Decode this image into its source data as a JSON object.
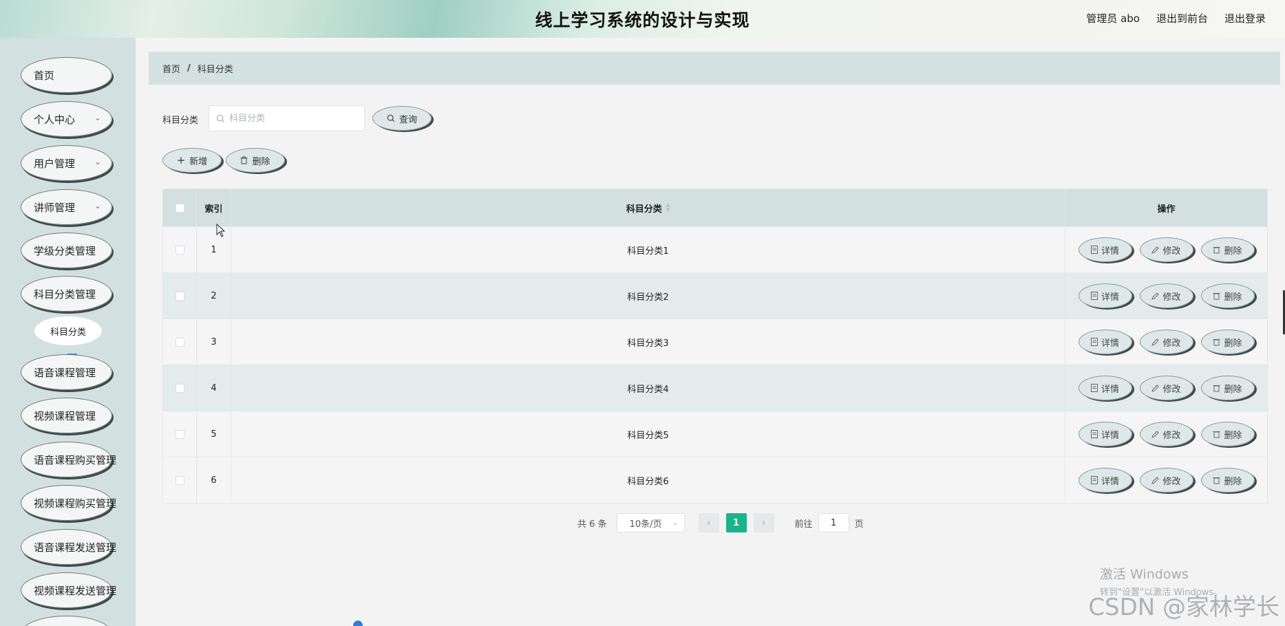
{
  "header": {
    "title": "线上学习系统的设计与实现",
    "user_label": "管理员 abo",
    "front_link": "退出到前台",
    "logout_link": "退出登录"
  },
  "sidebar": {
    "items": [
      {
        "label": "首页",
        "has_arrow": false
      },
      {
        "label": "个人中心",
        "has_arrow": true
      },
      {
        "label": "用户管理",
        "has_arrow": true
      },
      {
        "label": "讲师管理",
        "has_arrow": true
      },
      {
        "label": "学级分类管理",
        "has_arrow": false
      },
      {
        "label": "科目分类管理",
        "has_arrow": false
      },
      {
        "label": "语音课程管理",
        "has_arrow": false
      },
      {
        "label": "视频课程管理",
        "has_arrow": false
      },
      {
        "label": "语音课程购买管理",
        "has_arrow": false
      },
      {
        "label": "视频课程购买管理",
        "has_arrow": false
      },
      {
        "label": "语音课程发送管理",
        "has_arrow": false
      },
      {
        "label": "视频课程发送管理",
        "has_arrow": false
      }
    ],
    "sub_item": "科目分类"
  },
  "breadcrumb": {
    "home": "首页",
    "separator": "/",
    "current": "科目分类"
  },
  "search": {
    "label": "科目分类",
    "placeholder": "科目分类",
    "button": "查询"
  },
  "actions": {
    "add": "新增",
    "delete": "删除"
  },
  "table": {
    "headers": {
      "index": "索引",
      "name": "科目分类",
      "ops": "操作"
    },
    "rows": [
      {
        "index": "1",
        "name": "科目分类1"
      },
      {
        "index": "2",
        "name": "科目分类2"
      },
      {
        "index": "3",
        "name": "科目分类3"
      },
      {
        "index": "4",
        "name": "科目分类4"
      },
      {
        "index": "5",
        "name": "科目分类5"
      },
      {
        "index": "6",
        "name": "科目分类6"
      }
    ],
    "row_actions": {
      "detail": "详情",
      "edit": "修改",
      "delete": "删除"
    }
  },
  "pagination": {
    "total": "共 6 条",
    "page_size": "10条/页",
    "current_page": "1",
    "goto_label": "前往",
    "goto_value": "1",
    "page_suffix": "页"
  },
  "watermark": {
    "line1": "激活 Windows",
    "line2": "转到\"设置\"以激活 Windows。",
    "csdn": "CSDN @家林学长"
  },
  "colors": {
    "accent": "#1bb38a",
    "sidebar_bg": "#d2e0e0",
    "table_header_bg": "#d2e0e0"
  }
}
